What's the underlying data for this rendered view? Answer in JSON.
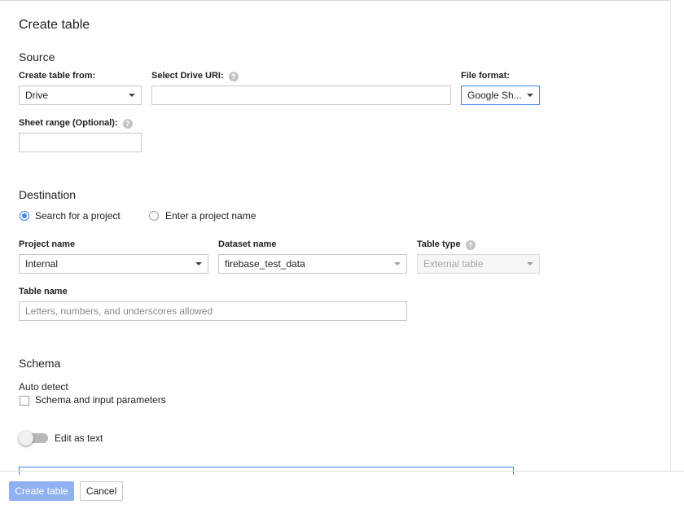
{
  "page": {
    "title": "Create table"
  },
  "source": {
    "heading": "Source",
    "create_from": {
      "label": "Create table from:",
      "value": "Drive"
    },
    "drive_uri": {
      "label": "Select Drive URI:",
      "value": "",
      "help_icon": "help-circle-icon"
    },
    "file_format": {
      "label": "File format:",
      "value": "Google Sh..."
    },
    "sheet_range": {
      "label": "Sheet range (Optional):",
      "value": "",
      "help_icon": "help-circle-icon"
    }
  },
  "destination": {
    "heading": "Destination",
    "options": [
      {
        "label": "Search for a project",
        "checked": true
      },
      {
        "label": "Enter a project name",
        "checked": false
      }
    ],
    "project_name": {
      "label": "Project name",
      "value": "Internal"
    },
    "dataset_name": {
      "label": "Dataset name",
      "value": "firebase_test_data"
    },
    "table_type": {
      "label": "Table type",
      "value": "External table",
      "help_icon": "help-circle-icon"
    },
    "table_name": {
      "label": "Table name",
      "placeholder": "Letters, numbers, and underscores allowed"
    }
  },
  "schema": {
    "heading": "Schema",
    "auto_detect_label": "Auto detect",
    "auto_detect_option": "Schema and input parameters",
    "edit_as_text": "Edit as text"
  },
  "footer": {
    "create_button": "Create table",
    "cancel_button": "Cancel"
  },
  "colors": {
    "accent": "#4285f4",
    "primary_button_disabled": "#8fb1ef"
  }
}
